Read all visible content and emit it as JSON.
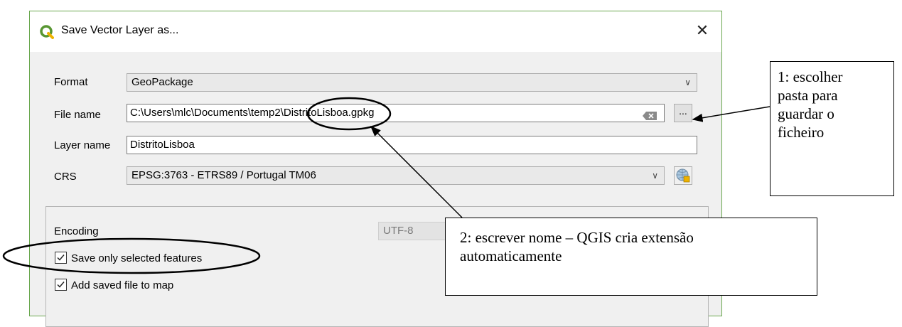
{
  "dialog": {
    "title": "Save Vector Layer as...",
    "close_glyph": "✕"
  },
  "form": {
    "format": {
      "label": "Format",
      "value": "GeoPackage"
    },
    "file_name": {
      "label": "File name",
      "value": "C:\\Users\\mlc\\Documents\\temp2\\DistritoLisboa.gpkg",
      "browse_label": "..."
    },
    "layer_name": {
      "label": "Layer name",
      "value": "DistritoLisboa"
    },
    "crs": {
      "label": "CRS",
      "value": "EPSG:3763 - ETRS89 / Portugal TM06"
    }
  },
  "options": {
    "encoding": {
      "label": "Encoding",
      "value": "UTF-8"
    },
    "save_selected": {
      "label": "Save only selected features",
      "checked": true
    },
    "add_to_map": {
      "label": "Add saved file to map",
      "checked": true
    }
  },
  "callouts": {
    "folder": {
      "line1": "1: escolher",
      "line2": "pasta para",
      "line3": "guardar o",
      "line4": "ficheiro"
    },
    "name": {
      "line1": "2: escrever nome – QGIS cria extensão",
      "line2": "automaticamente"
    }
  },
  "colors": {
    "qgis_green": "#589632",
    "qgis_yellow": "#eeb200",
    "frame_border": "#6aa84f"
  }
}
